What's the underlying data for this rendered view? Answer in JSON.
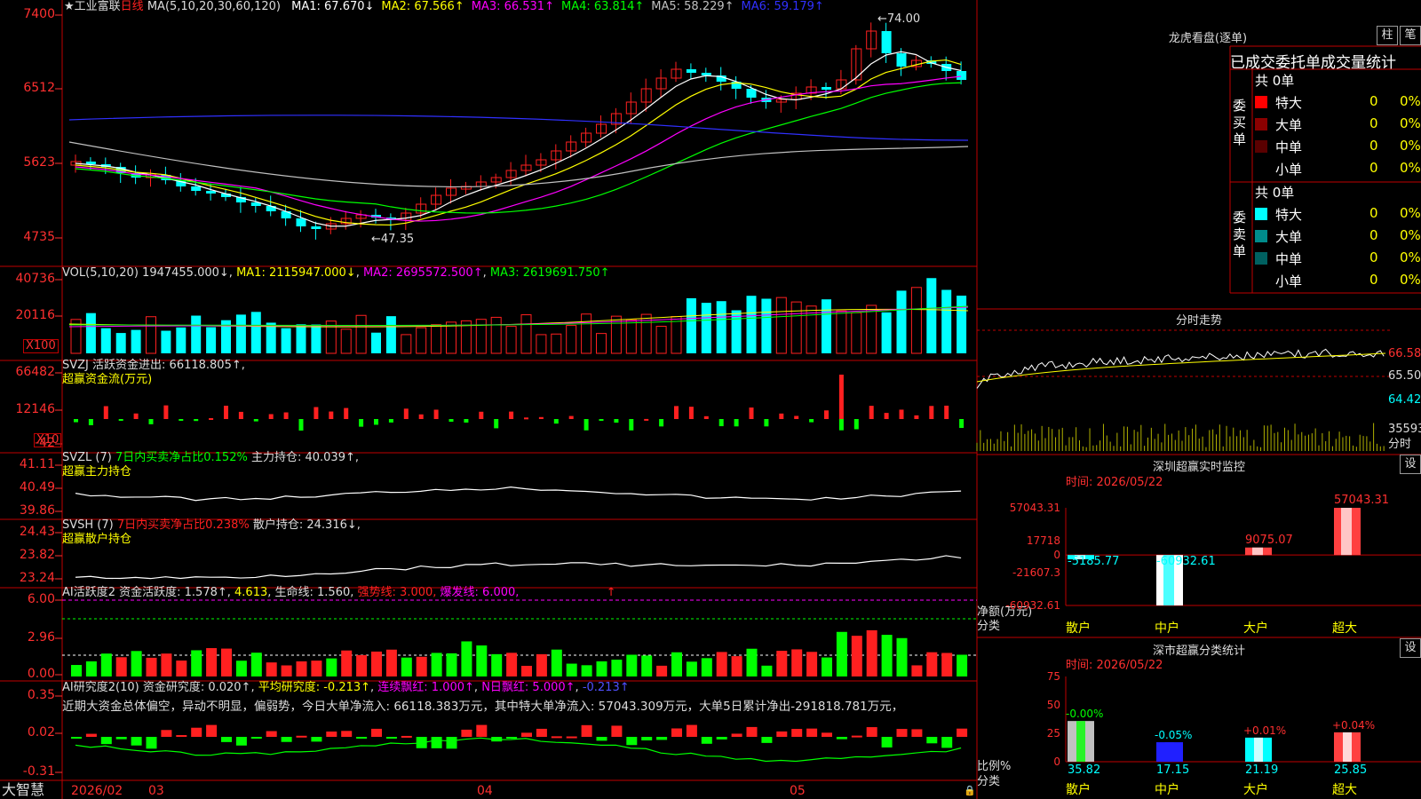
{
  "colors": {
    "up": "#ff2020",
    "down": "#00ffff",
    "ma1": "#ffffff",
    "ma2": "#ffff00",
    "ma3": "#ff00ff",
    "ma4": "#00ff00",
    "ma5": "#c0c0c0",
    "ma6": "#3030ff",
    "green": "#00ff00",
    "yellow": "#ffff00",
    "magenta": "#ff00ff"
  },
  "main": {
    "star": "★",
    "name": "工业富联",
    "period": "日线",
    "ma_params": "MA(5,10,20,30,60,120)",
    "ma_values": [
      {
        "label": "MA1: 67.670↓",
        "color": "#ffffff"
      },
      {
        "label": "MA2: 67.566↑",
        "color": "#ffff00"
      },
      {
        "label": "MA3: 66.531↑",
        "color": "#ff00ff"
      },
      {
        "label": "MA4: 63.814↑",
        "color": "#00ff00"
      },
      {
        "label": "MA5: 58.229↑",
        "color": "#c0c0c0"
      },
      {
        "label": "MA6: 59.179↑",
        "color": "#3030ff"
      }
    ],
    "y_ticks": [
      "7400",
      "6512",
      "5623",
      "4735"
    ],
    "high_label": "74.00",
    "low_label": "47.35"
  },
  "vol": {
    "header": "VOL(5,10,20)",
    "value": "1947455.000↓",
    "ma1": "MA1: 2115947.000↓",
    "ma2": "MA2: 2695572.500↑",
    "ma3": "MA3: 2619691.750↑",
    "y_ticks": [
      "40736",
      "20116"
    ],
    "unit": "X100"
  },
  "svzj": {
    "header": "SVZJ",
    "label": "活跃资金进出: 66118.805↑,",
    "subtitle": "超赢资金流(万元)",
    "y_ticks": [
      "66482",
      "12146",
      "-42"
    ],
    "unit": "X10"
  },
  "svzl": {
    "header": "SVZL (7)",
    "pct": "7日内买卖净占比0.152%",
    "hold": "主力持仓: 40.039↑,",
    "subtitle": "超赢主力持仓",
    "y_ticks": [
      "41.11",
      "40.49",
      "39.86"
    ]
  },
  "svsh": {
    "header": "SVSH (7)",
    "pct": "7日内买卖净占比0.238%",
    "hold": "散户持仓: 24.316↓,",
    "subtitle": "超赢散户持仓",
    "y_ticks": [
      "24.43",
      "23.82",
      "23.24"
    ]
  },
  "ai1": {
    "header": "AI活跃度2",
    "act": "资金活跃度: 1.578↑",
    "v2": "4.613",
    "life": "生命线: 1.560,",
    "strong": "强势线: 3.000,",
    "burst": "爆发线: 6.000,",
    "arrow": "↑",
    "y_ticks": [
      "6.00",
      "2.96",
      "0.00"
    ]
  },
  "ai2": {
    "header": "AI研究度2(10)",
    "res": "资金研究度: 0.020↑",
    "avg": "平均研究度: -0.213↑",
    "red": "连续飘红: 1.000↑",
    "nred": "N日飘红: 5.000↑",
    "neg": "-0.213↑",
    "comment": "近期大资金总体偏空，异动不明显，偏弱势，今日大单净流入: 66118.383万元，其中特大单净流入: 57043.309万元，大单5日累计净出-291818.781万元，",
    "y_ticks": [
      "0.35",
      "0.02",
      "-0.31"
    ]
  },
  "xaxis": {
    "brand": "大智慧",
    "labels": [
      "2026/02",
      "03",
      "04",
      "05"
    ]
  },
  "dragon": {
    "title": "龙虎看盘(逐单)",
    "btn1": "柱",
    "btn2": "笔",
    "tabs": "已成交委托单成交量统计",
    "buy": {
      "side": "委买单",
      "count": "共 0单",
      "rows": [
        {
          "label": "特大",
          "color": "#ff0000",
          "v": "0",
          "p": "0%"
        },
        {
          "label": "大单",
          "color": "#8b0000",
          "v": "0",
          "p": "0%"
        },
        {
          "label": "中单",
          "color": "#5a0000",
          "v": "0",
          "p": "0%"
        },
        {
          "label": "小单",
          "color": "",
          "v": "0",
          "p": "0%"
        }
      ]
    },
    "sell": {
      "side": "委卖单",
      "count": "共 0单",
      "rows": [
        {
          "label": "特大",
          "color": "#00ffff",
          "v": "0",
          "p": "0%"
        },
        {
          "label": "大单",
          "color": "#008b8b",
          "v": "0",
          "p": "0%"
        },
        {
          "label": "中单",
          "color": "#006060",
          "v": "0",
          "p": "0%"
        },
        {
          "label": "小单",
          "color": "",
          "v": "0",
          "p": "0%"
        }
      ]
    }
  },
  "intraday": {
    "title": "分时走势",
    "ticks": [
      "66.58",
      "65.50",
      "64.42",
      "35593"
    ],
    "unit": "分时"
  },
  "szmon": {
    "title": "深圳超赢实时监控",
    "btn": "设",
    "time": "时间: 2026/05/22",
    "y_ticks": [
      "57043.31",
      "17718",
      "0",
      "-21607.3",
      "-60932.61"
    ],
    "ylabel": "净额(万元)",
    "xlabel": "分类"
  },
  "szcls": {
    "title": "深市超赢分类统计",
    "btn": "设",
    "time": "时间: 2026/05/22",
    "y_ticks": [
      "75",
      "50",
      "25",
      "0"
    ],
    "ylabel": "比例%",
    "xlabel": "分类"
  },
  "chart_data": [
    {
      "type": "bar",
      "title": "深圳超赢实时监控",
      "categories": [
        "散户",
        "中户",
        "大户",
        "超大"
      ],
      "values": [
        -5185.77,
        -60932.61,
        9075.07,
        57043.31
      ],
      "ylabel": "净额(万元)",
      "xlabel": "分类",
      "ylim": [
        -60932.61,
        57043.31
      ]
    },
    {
      "type": "bar",
      "title": "深市超赢分类统计",
      "categories": [
        "散户",
        "中户",
        "大户",
        "超大"
      ],
      "values": [
        35.82,
        17.15,
        21.19,
        25.85
      ],
      "labels": [
        "-0.00%",
        "-0.05%",
        "+0.01%",
        "+0.04%"
      ],
      "ylabel": "比例%",
      "xlabel": "分类",
      "ylim": [
        0,
        75
      ]
    }
  ]
}
